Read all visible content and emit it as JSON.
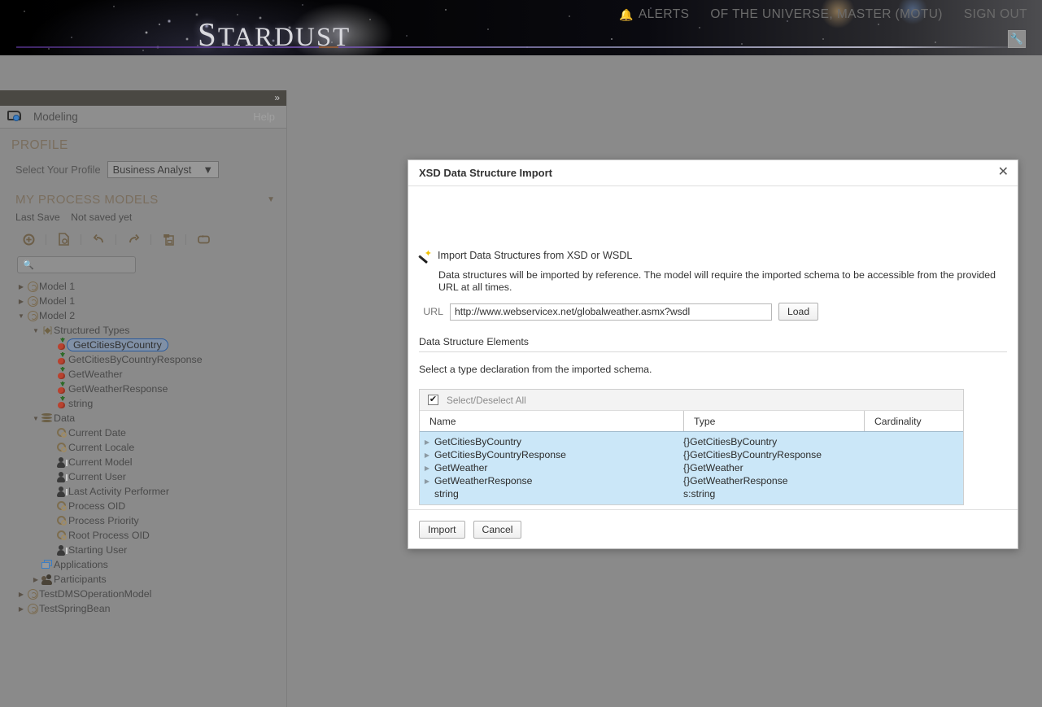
{
  "banner": {
    "brand_first": "S",
    "brand_rest": "TARDUST"
  },
  "topnav": {
    "alerts_icon": "bell-icon",
    "alerts": "ALERTS",
    "user": "OF THE UNIVERSE, MASTER (MOTU)",
    "signout": "SIGN OUT",
    "tool_icon": "wrench-icon"
  },
  "sidebar": {
    "collapse_icon": "»",
    "tab_label": "Modeling",
    "tab_icon": "modeling-icon",
    "help": "Help",
    "profile_section": "PROFILE",
    "profile_label": "Select Your Profile",
    "profile_value": "Business Analyst",
    "models_section": "MY PROCESS MODELS",
    "last_save_label": "Last Save",
    "last_save_value": "Not saved yet",
    "search_placeholder": "",
    "search_value": "",
    "toolbar": [
      {
        "name": "new-model-button",
        "icon": "plus-circle-icon"
      },
      {
        "name": "open-model-button",
        "icon": "document-search-icon"
      },
      {
        "name": "undo-button",
        "icon": "undo-arrow-icon"
      },
      {
        "name": "redo-button",
        "icon": "redo-arrow-icon"
      },
      {
        "name": "save-button",
        "icon": "save-copy-icon"
      },
      {
        "name": "refresh-button",
        "icon": "loop-icon"
      }
    ],
    "tree": [
      {
        "label": "Model 1",
        "icon": "model-icon",
        "indent": 0,
        "twisty": "collapsed"
      },
      {
        "label": "Model 1",
        "icon": "model-icon",
        "indent": 0,
        "twisty": "collapsed"
      },
      {
        "label": "Model 2",
        "icon": "model-icon",
        "indent": 0,
        "twisty": "expanded"
      },
      {
        "label": "Structured Types",
        "icon": "structured-types-icon",
        "indent": 1,
        "twisty": "expanded"
      },
      {
        "label": "GetCitiesByCountry",
        "icon": "type-icon",
        "indent": 2,
        "twisty": "none",
        "selected": true
      },
      {
        "label": "GetCitiesByCountryResponse",
        "icon": "type-icon",
        "indent": 2,
        "twisty": "none"
      },
      {
        "label": "GetWeather",
        "icon": "type-icon",
        "indent": 2,
        "twisty": "none"
      },
      {
        "label": "GetWeatherResponse",
        "icon": "type-icon",
        "indent": 2,
        "twisty": "none"
      },
      {
        "label": "string",
        "icon": "type-icon",
        "indent": 2,
        "twisty": "none"
      },
      {
        "label": "Data",
        "icon": "data-icon",
        "indent": 1,
        "twisty": "expanded"
      },
      {
        "label": "Current Date",
        "icon": "gear-icon",
        "indent": 2,
        "twisty": "none"
      },
      {
        "label": "Current Locale",
        "icon": "gear-icon",
        "indent": 2,
        "twisty": "none"
      },
      {
        "label": "Current Model",
        "icon": "user-icon",
        "indent": 2,
        "twisty": "none"
      },
      {
        "label": "Current User",
        "icon": "user-icon",
        "indent": 2,
        "twisty": "none"
      },
      {
        "label": "Last Activity Performer",
        "icon": "user-icon",
        "indent": 2,
        "twisty": "none"
      },
      {
        "label": "Process OID",
        "icon": "gear-icon",
        "indent": 2,
        "twisty": "none"
      },
      {
        "label": "Process Priority",
        "icon": "gear-icon",
        "indent": 2,
        "twisty": "none"
      },
      {
        "label": "Root Process OID",
        "icon": "gear-icon",
        "indent": 2,
        "twisty": "none"
      },
      {
        "label": "Starting User",
        "icon": "user-icon",
        "indent": 2,
        "twisty": "none"
      },
      {
        "label": "Applications",
        "icon": "applications-icon",
        "indent": 1,
        "twisty": "none"
      },
      {
        "label": "Participants",
        "icon": "participants-icon",
        "indent": 1,
        "twisty": "collapsed"
      },
      {
        "label": "TestDMSOperationModel",
        "icon": "model-icon",
        "indent": 0,
        "twisty": "collapsed"
      },
      {
        "label": "TestSpringBean",
        "icon": "model-icon",
        "indent": 0,
        "twisty": "collapsed"
      }
    ]
  },
  "modal": {
    "title": "XSD Data Structure Import",
    "close_icon": "close-icon",
    "wand_icon": "magic-wand-icon",
    "import_title": "Import Data Structures from XSD or WSDL",
    "import_desc": "Data structures will be imported by reference. The model will require the imported schema to be accessible from the provided URL at all times.",
    "url_label": "URL",
    "url_value": "http://www.webservicex.net/globalweather.asmx?wsdl",
    "url_placeholder": "",
    "load_label": "Load",
    "elements_title": "Data Structure Elements",
    "elements_sub": "Select a type declaration from the imported schema.",
    "select_all_label": "Select/Deselect All",
    "select_all_checked": "✔",
    "columns": [
      "Name",
      "Type",
      "Cardinality"
    ],
    "rows": [
      {
        "name": "GetCitiesByCountry",
        "type": "{}GetCitiesByCountry",
        "cardinality": "",
        "expandable": true
      },
      {
        "name": "GetCitiesByCountryResponse",
        "type": "{}GetCitiesByCountryResponse",
        "cardinality": "",
        "expandable": true
      },
      {
        "name": "GetWeather",
        "type": "{}GetWeather",
        "cardinality": "",
        "expandable": true
      },
      {
        "name": "GetWeatherResponse",
        "type": "{}GetWeatherResponse",
        "cardinality": "",
        "expandable": true
      },
      {
        "name": "string",
        "type": "s:string",
        "cardinality": "",
        "expandable": false
      }
    ],
    "import_button": "Import",
    "cancel_button": "Cancel"
  },
  "colors": {
    "overlay": "#8a8a8a",
    "row_highlight": "#cbe7f8",
    "accent_blue": "#3b7ec4",
    "selection_border": "#2a5b9e"
  }
}
